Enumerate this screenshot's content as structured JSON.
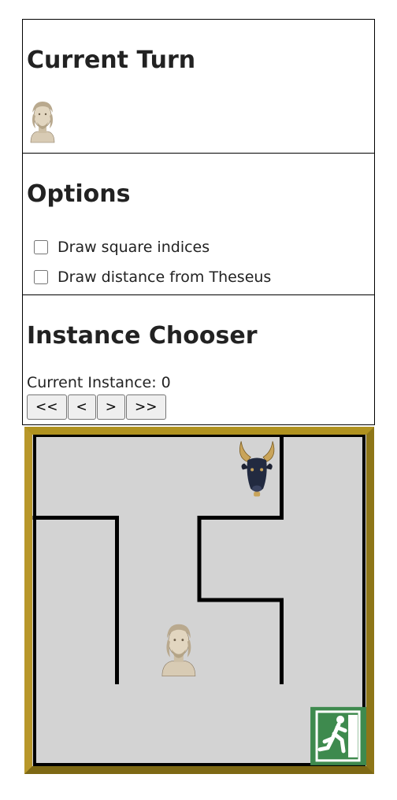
{
  "turn_panel": {
    "title": "Current Turn",
    "current_player_icon": "theseus-bust-icon"
  },
  "options_panel": {
    "title": "Options",
    "options": [
      {
        "label": "Draw square indices",
        "checked": false
      },
      {
        "label": "Draw distance from Theseus",
        "checked": false
      }
    ]
  },
  "instance_panel": {
    "title": "Instance Chooser",
    "current_label": "Current Instance: 0",
    "buttons": {
      "first": "<<",
      "prev": "<",
      "next": ">",
      "last": ">>"
    }
  },
  "maze": {
    "rows": 4,
    "cols": 4,
    "walls": [
      {
        "from": [
          3,
          0
        ],
        "to": [
          3,
          1
        ]
      },
      {
        "from": [
          0,
          1
        ],
        "to": [
          1,
          1
        ]
      },
      {
        "from": [
          1,
          1
        ],
        "to": [
          1,
          3
        ]
      },
      {
        "from": [
          2,
          1
        ],
        "to": [
          3,
          1
        ]
      },
      {
        "from": [
          2,
          1
        ],
        "to": [
          2,
          2
        ]
      },
      {
        "from": [
          2,
          2
        ],
        "to": [
          3,
          2
        ]
      },
      {
        "from": [
          3,
          2
        ],
        "to": [
          3,
          3
        ]
      }
    ],
    "minotaur": {
      "col": 2.7,
      "row": 0.55
    },
    "theseus": {
      "col": 1.75,
      "row": 2.6
    },
    "exit": {
      "col": 3.35,
      "row": 3.3
    },
    "colors": {
      "floor": "#d3d3d3",
      "wall": "#000000",
      "frame": "#c4a32c",
      "exit_green": "#3e8a4e"
    }
  }
}
